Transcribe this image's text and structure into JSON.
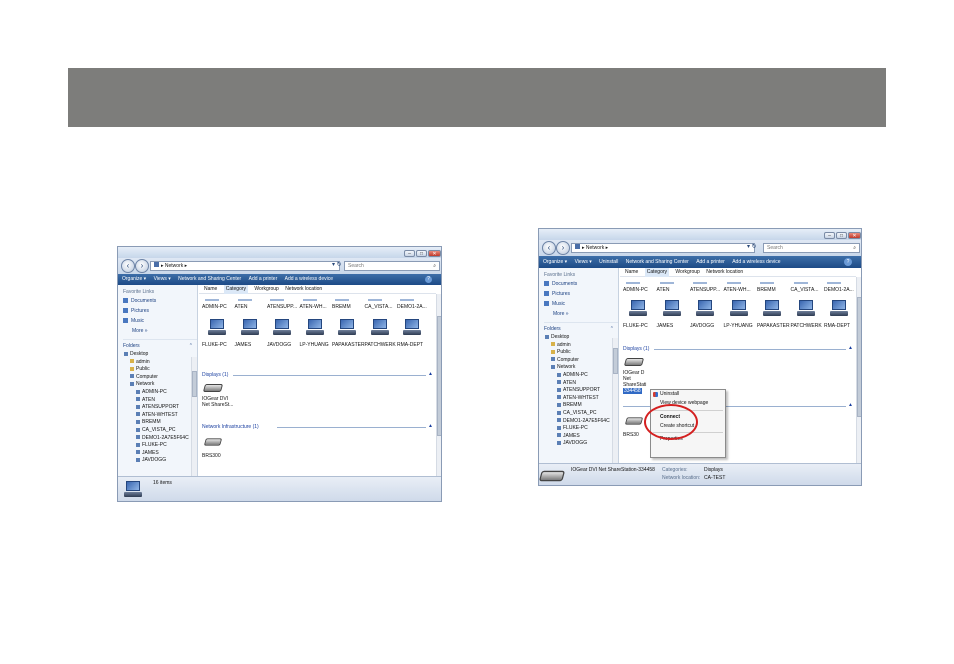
{
  "left_window": {
    "address": "▸ Network ▸",
    "search_placeholder": "Search",
    "toolbar": [
      "Organize ▾",
      "Views ▾",
      "Network and Sharing Center",
      "Add a printer",
      "Add a wireless device"
    ],
    "favorite_links_title": "Favorite Links",
    "favorite_links": [
      "Documents",
      "Pictures",
      "Music"
    ],
    "more_label": "More »",
    "folders_label": "Folders",
    "tree": [
      "Desktop",
      "admin",
      "Public",
      "Computer",
      "Network",
      "ADMIN-PC",
      "ATEN",
      "ATENSUPPORT",
      "ATEN-WHTEST",
      "BREMM",
      "CA_VISTA_PC",
      "DEMO1-2A7E5F64C",
      "FLUKE-PC",
      "JAMES",
      "JAVDOGG"
    ],
    "columns": [
      "Name",
      "Category",
      "Workgroup",
      "Network location"
    ],
    "computers_row1": [
      "ADMIN-PC",
      "ATEN",
      "ATENSUPP...",
      "ATEN-WH...",
      "BREMM",
      "CA_VISTA...",
      "DEMO1-2A..."
    ],
    "computers_row2": [
      "FLUKE-PC",
      "JAMES",
      "JAVDOGG",
      "LP-YHUANG",
      "PAPAKASTER",
      "PATCHWERK",
      "RMA-DEPT"
    ],
    "displays_group": "Displays (1)",
    "display_item": [
      "IOGear DVI",
      "Net ShareSt..."
    ],
    "infra_group": "Network Infrastructure (1)",
    "infra_item": "BRS300",
    "status_text": "16 items"
  },
  "right_window": {
    "address": "▸ Network ▸",
    "search_placeholder": "Search",
    "toolbar": [
      "Organize ▾",
      "Views ▾",
      "Uninstall",
      "Network and Sharing Center",
      "Add a printer",
      "Add a wireless device"
    ],
    "favorite_links_title": "Favorite Links",
    "favorite_links": [
      "Documents",
      "Pictures",
      "Music"
    ],
    "more_label": "More »",
    "folders_label": "Folders",
    "tree": [
      "Desktop",
      "admin",
      "Public",
      "Computer",
      "Network",
      "ADMIN-PC",
      "ATEN",
      "ATENSUPPORT",
      "ATEN-WHTEST",
      "BREMM",
      "CA_VISTA_PC",
      "DEMO1-2A7E5F64C",
      "FLUKE-PC",
      "JAMES",
      "JAVDOGG"
    ],
    "columns": [
      "Name",
      "Category",
      "Workgroup",
      "Network location"
    ],
    "computers_row1": [
      "ADMIN-PC",
      "ATEN",
      "ATENSUPP...",
      "ATEN-WH...",
      "BREMM",
      "CA_VISTA...",
      "DEMO1-2A..."
    ],
    "computers_row2": [
      "FLUKE-PC",
      "JAMES",
      "JAVDOGG",
      "LP-YHUANG",
      "PAPAKASTER",
      "PATCHWERK",
      "RMA-DEPT"
    ],
    "displays_group": "Displays (1)",
    "display_item": [
      "IOGear D",
      "Net",
      "ShareStati",
      "334458"
    ],
    "infra_item": "BRS30",
    "context_menu": [
      "Uninstall",
      "View device webpage",
      "Connect",
      "Create shortcut",
      "Properties"
    ],
    "details": {
      "name": "IOGear DVI Net ShareStation-334458",
      "categories_label": "Categories:",
      "categories_value": "Displays",
      "location_label": "Network location:",
      "location_value": "CA-TEST"
    }
  },
  "colors": {
    "header_bar": "#7d7d7b",
    "toolbar": "#2a5a96",
    "connect_ring": "#d42020"
  }
}
